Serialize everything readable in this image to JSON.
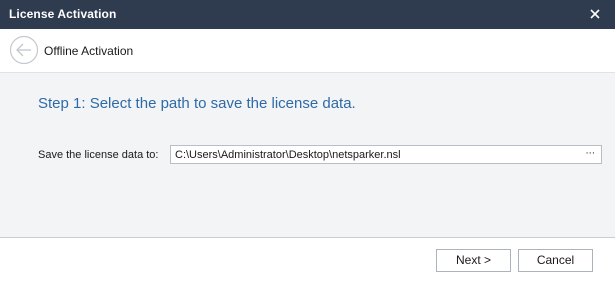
{
  "window": {
    "title": "License Activation"
  },
  "header": {
    "subtitle": "Offline Activation"
  },
  "content": {
    "step_title": "Step 1: Select the path to save the license data.",
    "path_label": "Save the license data to:",
    "path_value": "C:\\Users\\Administrator\\Desktop\\netsparker.nsl",
    "browse_label": "···"
  },
  "footer": {
    "next_label": "Next >",
    "cancel_label": "Cancel"
  },
  "icons": {
    "close": "close-icon",
    "back": "back-arrow-icon"
  },
  "colors": {
    "titlebar": "#2f3b4f",
    "step_title": "#2e6aa8",
    "content_bg": "#f3f4f6"
  }
}
